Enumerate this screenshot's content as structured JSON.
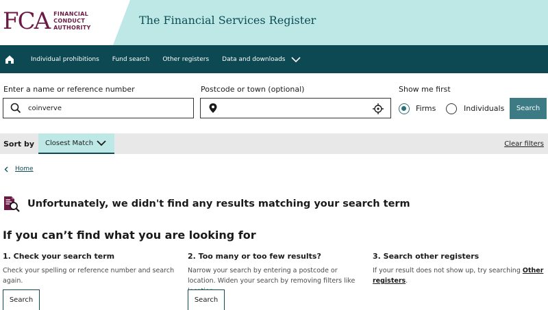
{
  "header": {
    "logo_mark": "FCA",
    "logo_line1": "FINANCIAL",
    "logo_line2": "CONDUCT",
    "logo_line3": "AUTHORITY",
    "title": "The Financial Services Register"
  },
  "nav": {
    "home_icon": "home-icon",
    "items": [
      "Individual prohibitions",
      "Fund search",
      "Other registers",
      "Data and downloads"
    ]
  },
  "search": {
    "name_label": "Enter a name or reference number",
    "name_value": "coinverve",
    "postcode_label": "Postcode or town (optional)",
    "postcode_value": "",
    "show_me_first_label": "Show me first",
    "firms_label": "Firms",
    "individuals_label": "Individuals",
    "selected": "Firms",
    "button_label": "Search"
  },
  "sort": {
    "label": "Sort by",
    "value": "Closest Match",
    "clear_filters": "Clear filters"
  },
  "breadcrumb": {
    "home": "Home"
  },
  "results": {
    "no_results_message": "Unfortunately, we didn't find any results matching your search term",
    "help_heading": "If you can’t find what you are looking for"
  },
  "help_columns": [
    {
      "title": "1. Check your search term",
      "text": "Check your spelling or reference number and search again.",
      "button": "Search"
    },
    {
      "title": "2. Too many or too few results?",
      "text": "Narrow your search by entering a postcode or location. Widen your search by removing filters like location.",
      "button": "Search"
    },
    {
      "title": "3. Search other registers",
      "text_before": "If your result does not show up, try searching ",
      "link": "Other registers",
      "text_after": "."
    }
  ],
  "colors": {
    "brand": "#6b1a45",
    "nav_bg": "#0d4952",
    "banner": "#bde8e6",
    "button": "#3c7a84"
  }
}
